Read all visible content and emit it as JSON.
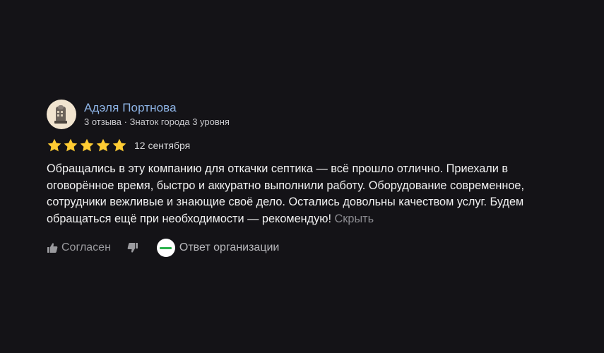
{
  "review": {
    "author": {
      "name": "Адэля Портнова",
      "meta": "3 отзыва · Знаток города 3 уровня"
    },
    "rating": 5,
    "rating_max": 5,
    "date": "12 сентября",
    "text": "Обращались в эту компанию для откачки септика — всё прошло отлично. Приехали в оговорённое время, быстро и аккуратно выполнили работу. Оборудование современное, сотрудники вежливые и знающие своё дело. Остались довольны качеством услуг. Будем обращаться ещё при необходимости — рекомендую!",
    "hide_label": "Скрыть",
    "actions": {
      "agree_label": "Согласен",
      "org_reply_label": "Ответ организации"
    }
  },
  "colors": {
    "background": "#141317",
    "author_name": "#8eb4e6",
    "star": "#ffcc33",
    "org_logo_accent": "#2bb24c"
  },
  "icons": {
    "agree": "thumbs-up-icon",
    "disagree": "thumbs-down-icon",
    "star": "star-icon",
    "org_logo": "organization-logo"
  }
}
